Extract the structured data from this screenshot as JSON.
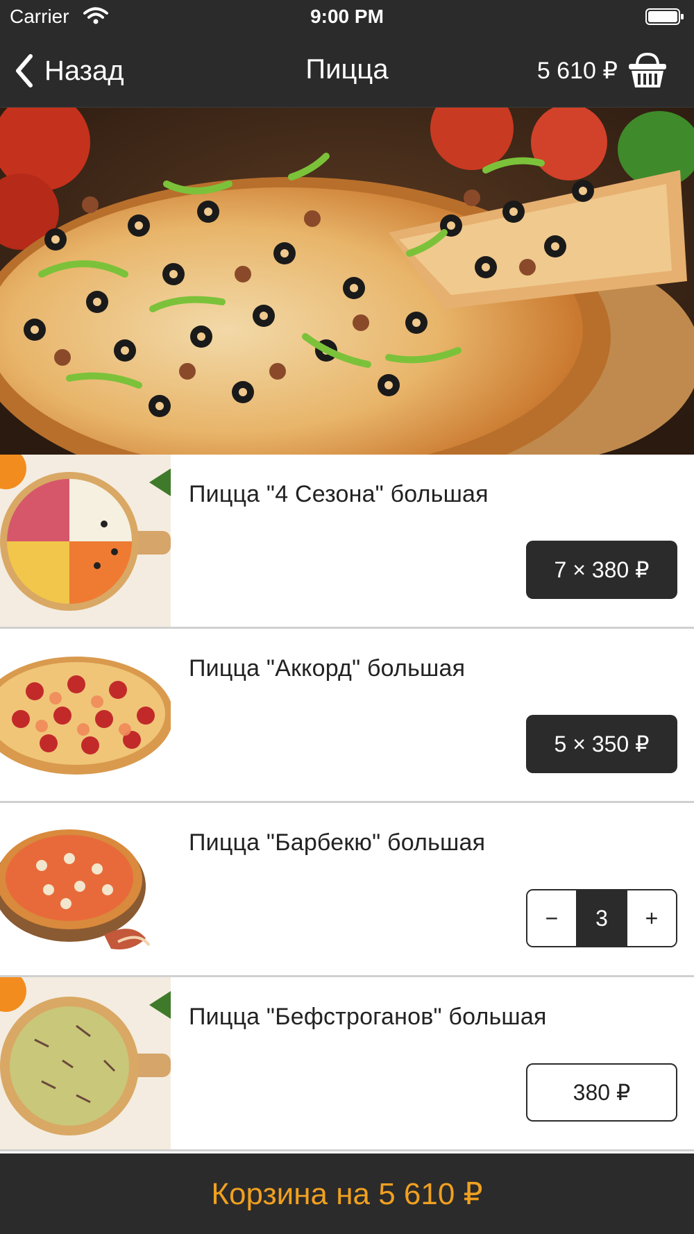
{
  "status_bar": {
    "carrier": "Carrier",
    "time": "9:00 PM"
  },
  "nav": {
    "back_label": "Назад",
    "title": "Пицца",
    "cart_total": "5 610 ₽"
  },
  "items": [
    {
      "name": "Пицца \"4 Сезона\" большая",
      "price_label": "7 × 380 ₽",
      "state": "in_cart"
    },
    {
      "name": "Пицца \"Аккорд\" большая",
      "price_label": "5 × 350 ₽",
      "state": "in_cart"
    },
    {
      "name": "Пицца \"Барбекю\" большая",
      "stepper": {
        "minus": "−",
        "value": "3",
        "plus": "+"
      },
      "state": "editing"
    },
    {
      "name": "Пицца \"Бефстроганов\" большая",
      "price_label": "380 ₽",
      "state": "not_in_cart"
    }
  ],
  "cart_bar": {
    "label": "Корзина на 5 610 ₽"
  },
  "colors": {
    "bar_background": "#2b2b2b",
    "accent": "#f0a020",
    "text_light": "#ffffff"
  }
}
